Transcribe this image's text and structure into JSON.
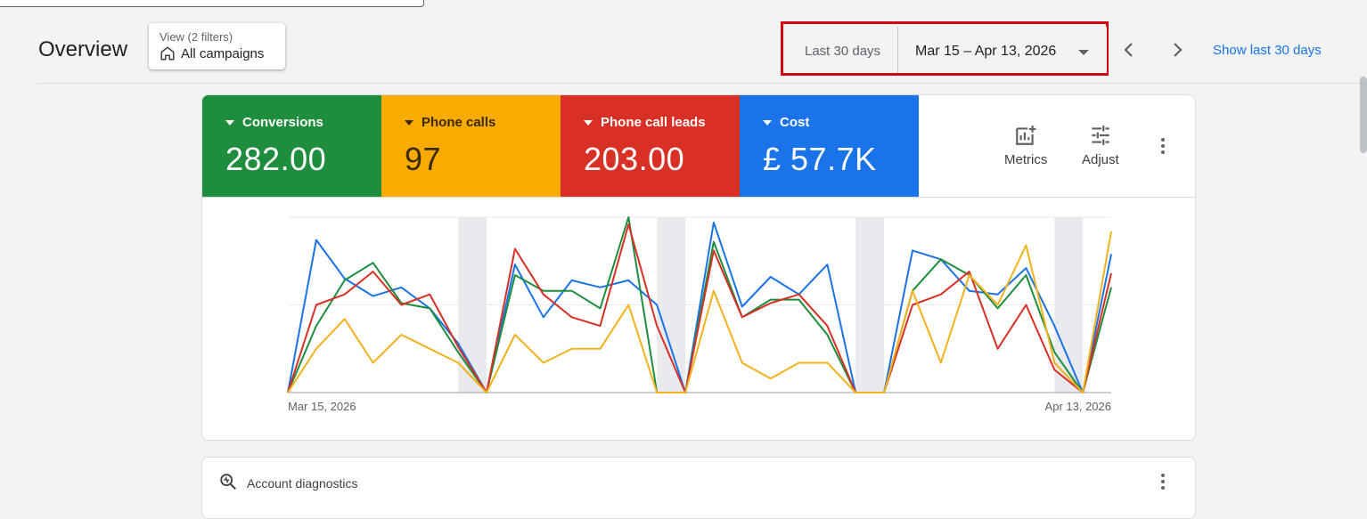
{
  "header": {
    "title": "Overview",
    "view_filter": {
      "sublabel": "View (2 filters)",
      "label": "All campaigns"
    }
  },
  "date_range": {
    "preset": "Last 30 days",
    "range": "Mar 15 – Apr 13, 2026",
    "show_last": "Show last 30 days"
  },
  "scorecards": [
    {
      "label": "Conversions",
      "value": "282.00",
      "color": "#1e8e3e"
    },
    {
      "label": "Phone calls",
      "value": "97",
      "color": "#f9ab00"
    },
    {
      "label": "Phone call leads",
      "value": "203.00",
      "color": "#d93025"
    },
    {
      "label": "Cost",
      "value": "£ 57.7K",
      "color": "#1a73e8"
    }
  ],
  "toolbar": {
    "metrics": "Metrics",
    "adjust": "Adjust"
  },
  "chart_data": {
    "type": "line",
    "x_start_label": "Mar 15, 2026",
    "x_end_label": "Apr 13, 2026",
    "x_ticks": [
      "Mar 15, 2026",
      "Apr 13, 2026"
    ],
    "shaded_days": [
      6,
      13,
      20,
      27
    ],
    "series": [
      {
        "color": "#1a73e8",
        "values": [
          0,
          0.87,
          0.65,
          0.55,
          0.6,
          0.48,
          0.28,
          0,
          0.73,
          0.43,
          0.64,
          0.6,
          0.64,
          0.5,
          0,
          0.97,
          0.49,
          0.66,
          0.56,
          0.73,
          0,
          0,
          0.81,
          0.76,
          0.58,
          0.56,
          0.71,
          0.38,
          0,
          0.79
        ]
      },
      {
        "color": "#1e8e3e",
        "values": [
          0,
          0.38,
          0.64,
          0.74,
          0.51,
          0.48,
          0.23,
          0,
          0.67,
          0.58,
          0.58,
          0.48,
          1.0,
          0,
          0,
          0.86,
          0.43,
          0.53,
          0.53,
          0.33,
          0,
          0,
          0.58,
          0.76,
          0.67,
          0.48,
          0.67,
          0.23,
          0,
          0.6
        ]
      },
      {
        "color": "#d93025",
        "values": [
          0,
          0.5,
          0.56,
          0.69,
          0.5,
          0.56,
          0.26,
          0,
          0.82,
          0.56,
          0.43,
          0.38,
          0.96,
          0.38,
          0,
          0.81,
          0.43,
          0.51,
          0.56,
          0.38,
          0,
          0,
          0.5,
          0.56,
          0.69,
          0.25,
          0.5,
          0.13,
          0,
          0.68
        ]
      },
      {
        "color": "#f2b21c",
        "values": [
          0,
          0.25,
          0.42,
          0.17,
          0.33,
          0.25,
          0.17,
          0,
          0.33,
          0.17,
          0.25,
          0.25,
          0.5,
          0,
          0,
          0.58,
          0.17,
          0.08,
          0.17,
          0.17,
          0,
          0,
          0.58,
          0.17,
          0.67,
          0.5,
          0.84,
          0.17,
          0,
          0.92
        ]
      }
    ],
    "ylim": [
      0,
      1
    ],
    "grid": true,
    "legend": "none"
  },
  "diagnostics": {
    "title": "Account diagnostics"
  }
}
